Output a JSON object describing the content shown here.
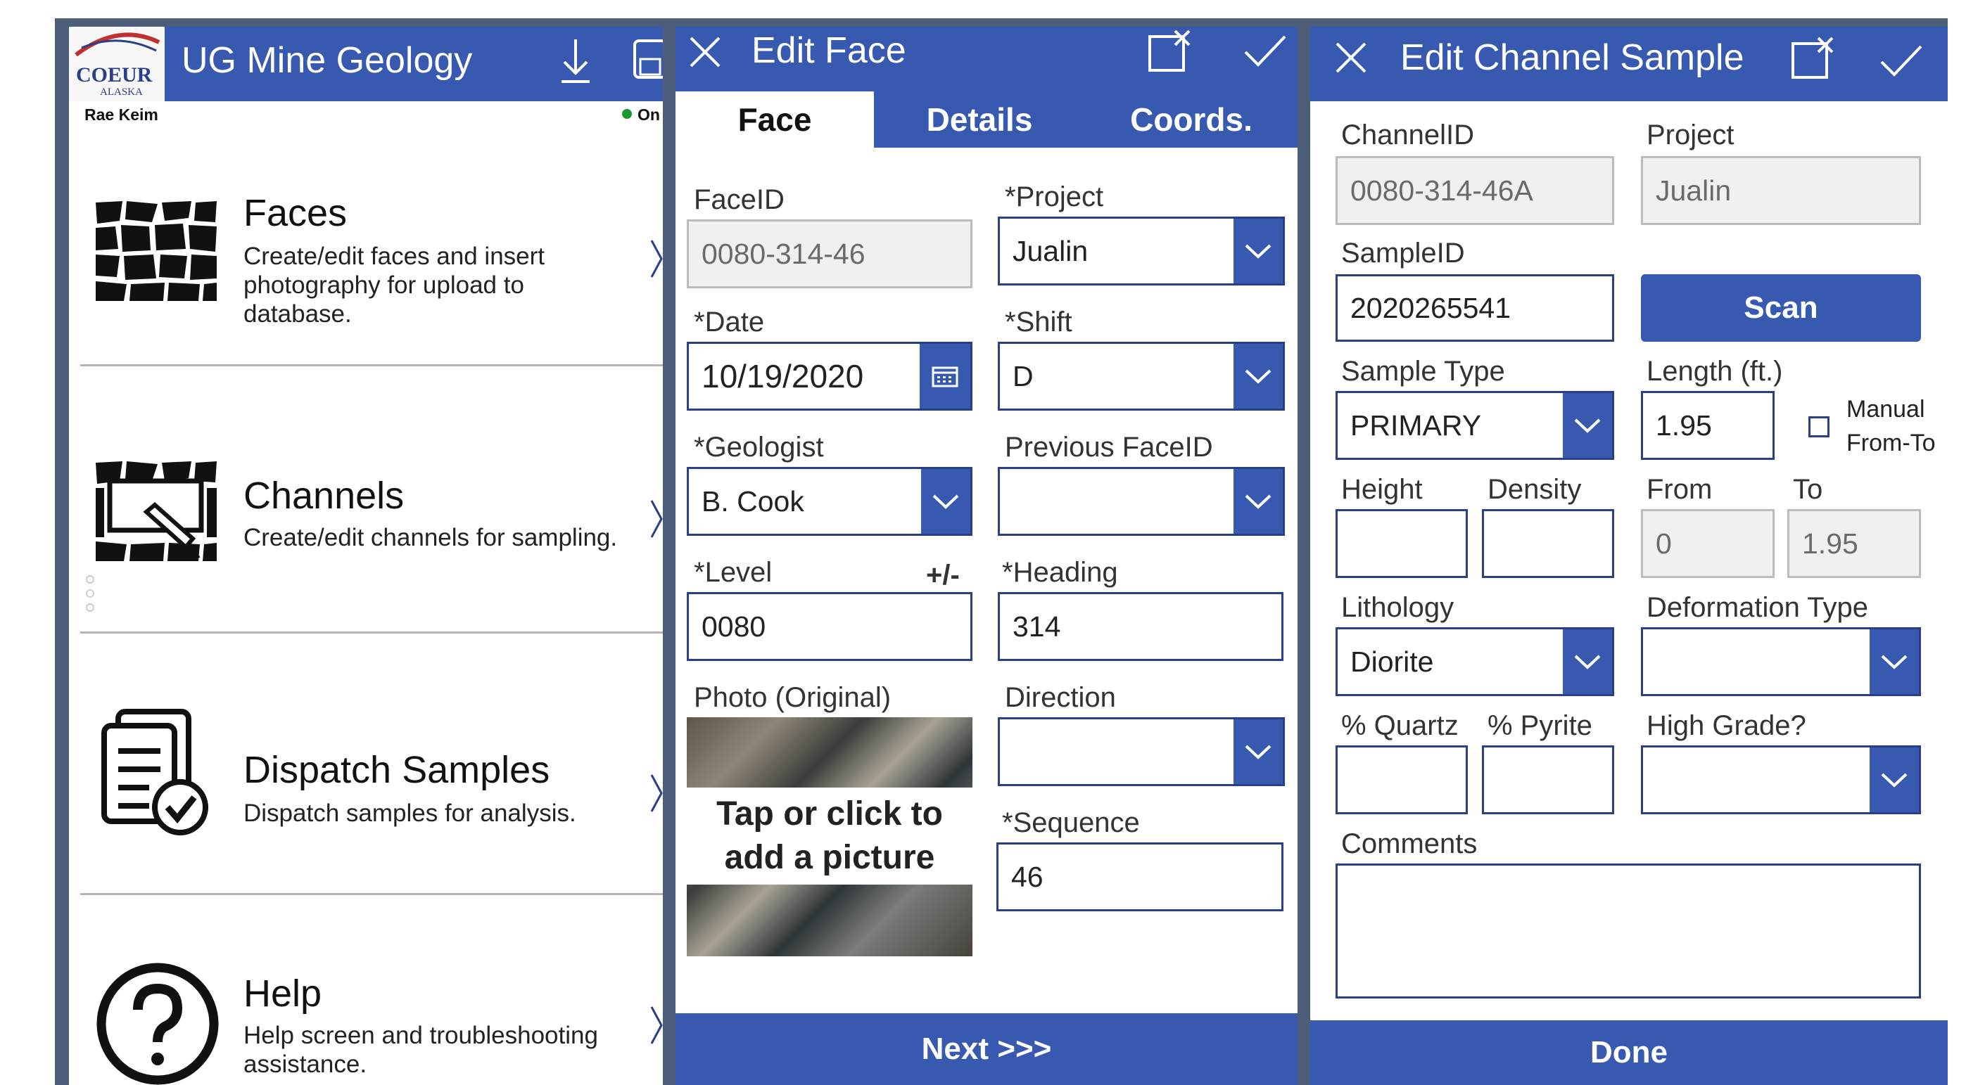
{
  "panel1": {
    "logo_text": "COEUR",
    "logo_sub": "ALASKA",
    "app_title": "UG Mine Geology",
    "user_name": "Rae Keim",
    "status_text": "On",
    "status_color": "#1a9a2a",
    "menu": [
      {
        "title": "Faces",
        "desc": "Create/edit faces and insert photography for upload to database.",
        "icon": "rock-face-icon"
      },
      {
        "title": "Channels",
        "desc": "Create/edit channels for sampling.",
        "icon": "channel-icon"
      },
      {
        "title": "Dispatch Samples",
        "desc": "Dispatch samples for analysis.",
        "icon": "clipboard-check-icon"
      },
      {
        "title": "Help",
        "desc": "Help screen and troubleshooting assistance.",
        "icon": "help-icon"
      }
    ]
  },
  "panel2": {
    "title": "Edit Face",
    "tabs": [
      "Face",
      "Details",
      "Coords."
    ],
    "active_tab": "Face",
    "faceid_label": "FaceID",
    "faceid_value": "0080-314-46",
    "project_label": "*Project",
    "project_value": "Jualin",
    "date_label": "*Date",
    "date_value": "10/19/2020",
    "shift_label": "*Shift",
    "shift_value": "D",
    "geologist_label": "*Geologist",
    "geologist_value": "B. Cook",
    "prev_faceid_label": "Previous FaceID",
    "prev_faceid_value": "",
    "level_label": "*Level",
    "level_pm": "+/-",
    "level_value": "0080",
    "heading_label": "*Heading",
    "heading_value": "314",
    "photo_label": "Photo (Original)",
    "photo_prompt": "Tap or click to add a picture",
    "direction_label": "Direction",
    "direction_value": "",
    "sequence_label": "*Sequence",
    "sequence_value": "46",
    "next_label": "Next >>>"
  },
  "panel3": {
    "title": "Edit Channel Sample",
    "channelid_label": "ChannelID",
    "channelid_value": "0080-314-46A",
    "project_label": "Project",
    "project_value": "Jualin",
    "sampleid_label": "SampleID",
    "sampleid_value": "2020265541",
    "scan_label": "Scan",
    "sample_type_label": "Sample Type",
    "sample_type_value": "PRIMARY",
    "length_label": "Length (ft.)",
    "length_value": "1.95",
    "manual_label": "Manual From-To",
    "height_label": "Height",
    "height_value": "",
    "density_label": "Density",
    "density_value": "",
    "from_label": "From",
    "from_value": "0",
    "to_label": "To",
    "to_value": "1.95",
    "lithology_label": "Lithology",
    "lithology_value": "Diorite",
    "deformation_label": "Deformation Type",
    "deformation_value": "",
    "quartz_label": "% Quartz",
    "quartz_value": "",
    "pyrite_label": "% Pyrite",
    "pyrite_value": "",
    "high_grade_label": "High Grade?",
    "high_grade_value": "",
    "comments_label": "Comments",
    "comments_value": "",
    "done_label": "Done"
  },
  "colors": {
    "accent": "#3859b0",
    "border": "#2a3f86",
    "frame": "#4d5f78"
  }
}
